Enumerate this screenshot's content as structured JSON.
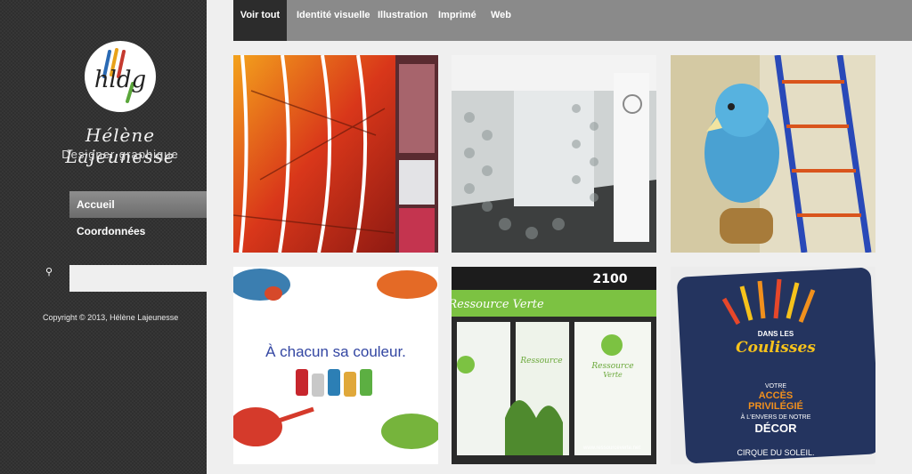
{
  "brand": {
    "name": "Hélène Lajeunesse",
    "tagline": "Designer graphique",
    "logo_text": "hldg"
  },
  "nav": {
    "items": [
      {
        "label": "Accueil",
        "active": true
      },
      {
        "label": "Coordonnées",
        "active": false
      }
    ]
  },
  "search": {
    "placeholder": "",
    "icon": "search-icon"
  },
  "footer": {
    "copyright": "Copyright © 2013, Hélène Lajeunesse"
  },
  "tabs": [
    {
      "label": "Voir tout",
      "active": true
    },
    {
      "label": "Identité visuelle",
      "active": false
    },
    {
      "label": "Illustration",
      "active": false
    },
    {
      "label": "Imprimé",
      "active": false
    },
    {
      "label": "Web",
      "active": false
    }
  ],
  "portfolio": {
    "tile4": {
      "caption": "À chacun sa couleur."
    },
    "tile5": {
      "number": "2100",
      "sign": "Ressource Verte",
      "window_logo_line1": "Ressource",
      "window_logo_line2": "Verte",
      "url": "www.ressourceverte.net"
    },
    "tile6": {
      "line1": "DANS LES",
      "line2": "Coulisses",
      "line3": "VOTRE",
      "line4": "ACCÈS",
      "line5": "PRIVILÉGIÉ",
      "line6": "À L'ENVERS DE NOTRE",
      "line7": "DÉCOR",
      "brand": "CIRQUE DU SOLEIL."
    }
  },
  "colors": {
    "sidebar_bg": "#2f2f2f",
    "topbar_bg": "#8a8a8a",
    "active_tab_bg": "#2c2c2c",
    "page_bg": "#efefef",
    "active_nav": "#7c7c7c"
  }
}
